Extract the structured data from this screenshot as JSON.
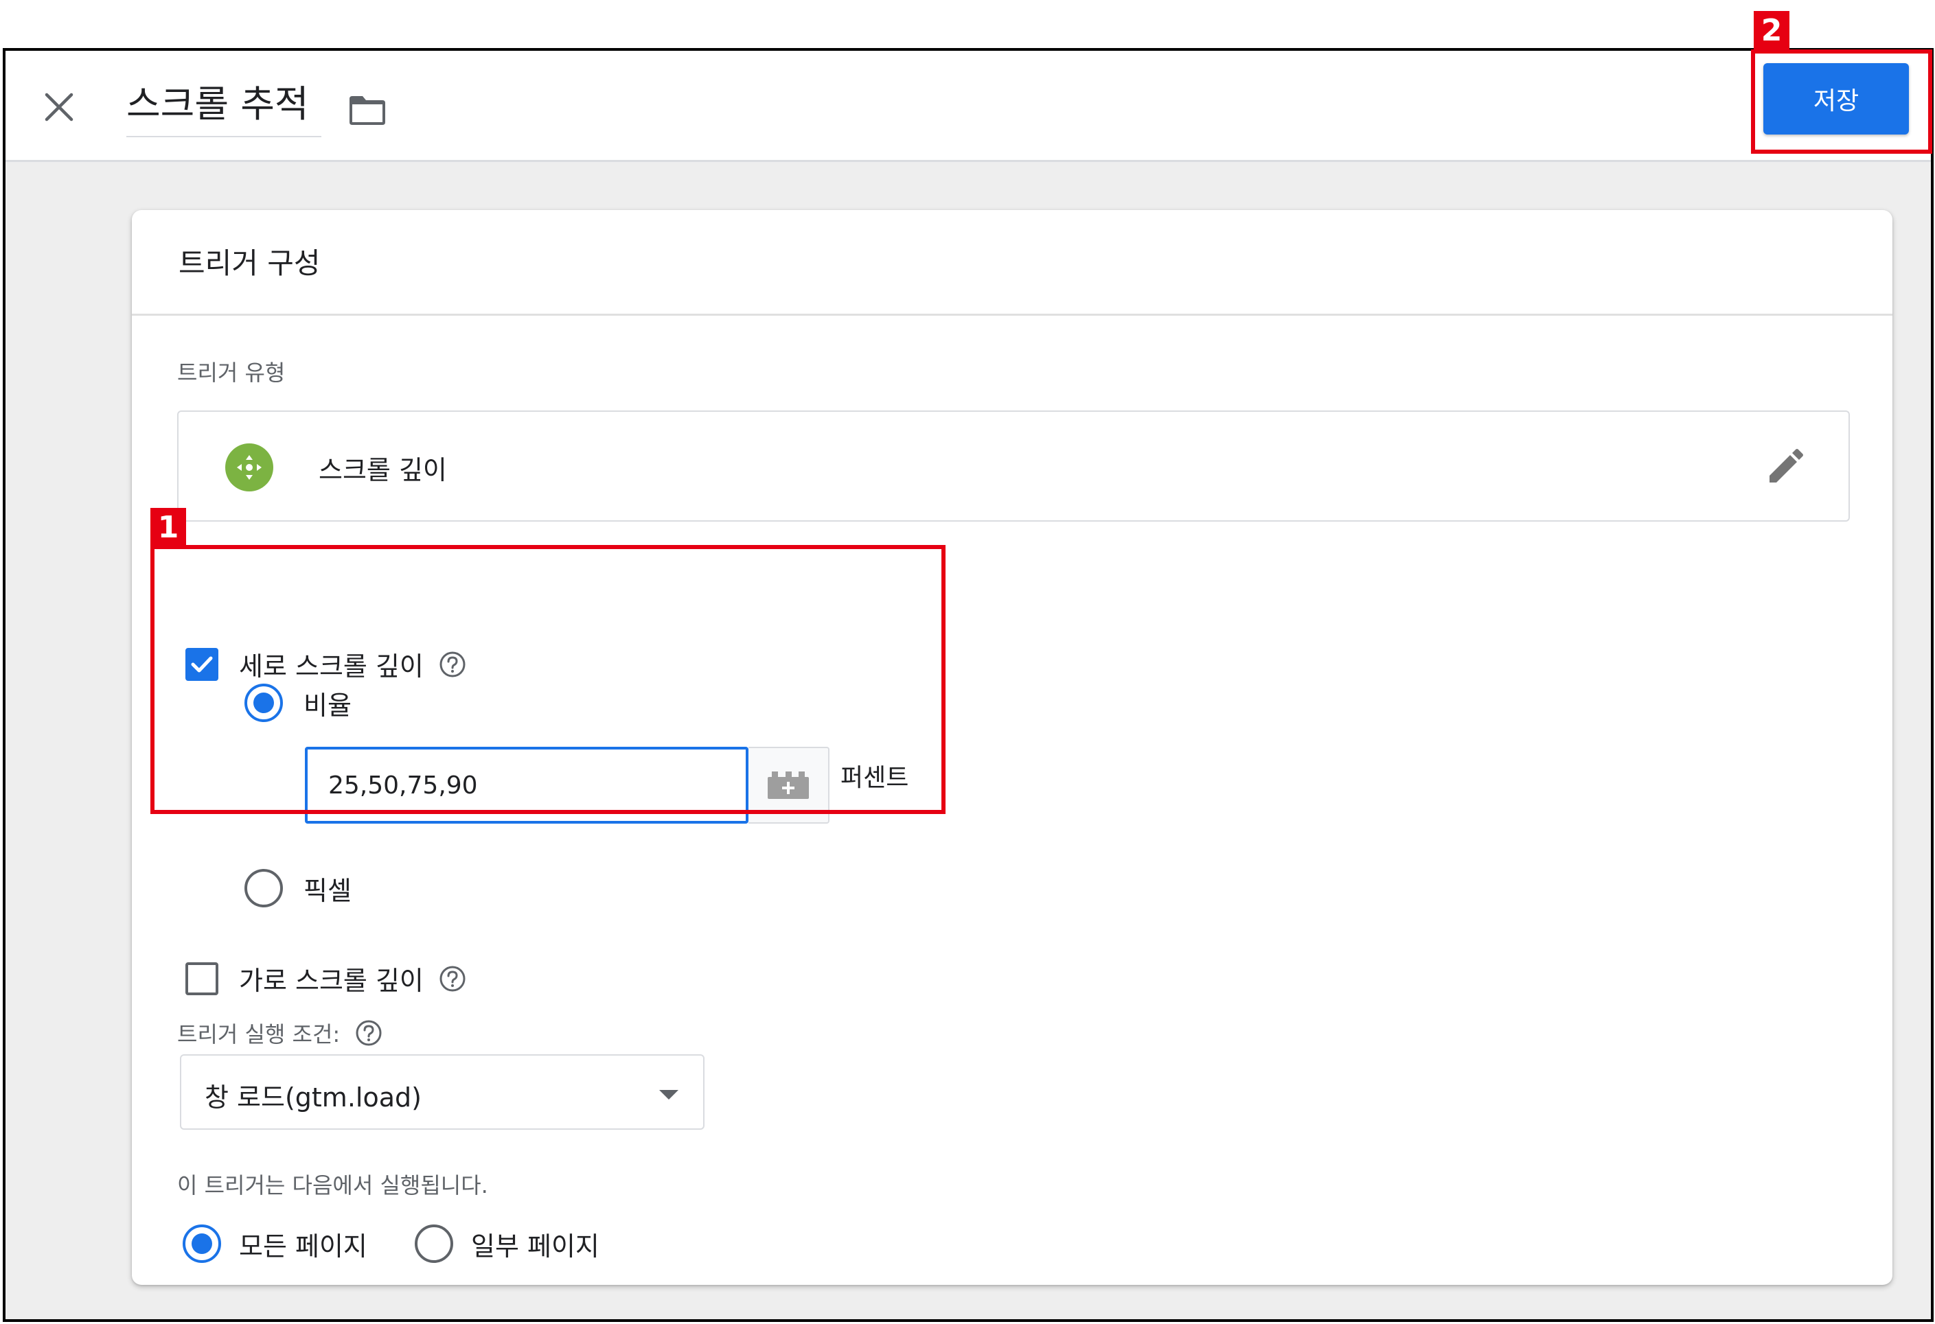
{
  "topbar": {
    "title": "스크롤 추적",
    "save_label": "저장",
    "close_icon": "close-icon",
    "folder_icon": "folder-icon"
  },
  "card": {
    "title": "트리거 구성",
    "trigger_type_label": "트리거 유형",
    "trigger_type": {
      "name": "스크롤 깊이",
      "icon": "scroll-depth-icon",
      "icon_color": "#7cb342",
      "edit_icon": "pencil-icon"
    },
    "vertical": {
      "label": "세로 스크롤 깊이",
      "checked": true,
      "options": [
        {
          "label": "비율",
          "selected": true
        },
        {
          "label": "픽셀",
          "selected": false
        }
      ],
      "value": "25,50,75,90",
      "unit": "퍼센트"
    },
    "horizontal": {
      "label": "가로 스크롤 깊이",
      "checked": false
    },
    "fire_on_label": "트리거 실행 조건:",
    "fire_on_value": "창 로드(gtm.load)",
    "fires_on_label": "이 트리거는 다음에서 실행됩니다.",
    "fires_on_options": [
      {
        "label": "모든 페이지",
        "selected": true
      },
      {
        "label": "일부 페이지",
        "selected": false
      }
    ]
  },
  "annotations": [
    {
      "number": "1"
    },
    {
      "number": "2"
    }
  ],
  "colors": {
    "accent": "#1a73e8",
    "annotation": "#e60012"
  }
}
